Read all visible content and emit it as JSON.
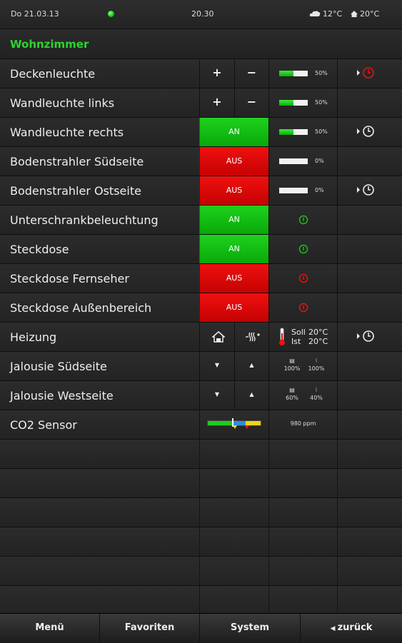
{
  "status": {
    "date": "Do 21.03.13",
    "time": "20.30",
    "outdoor_temp": "12°C",
    "indoor_temp": "20°C",
    "outdoor_icon": "cloud-icon",
    "indoor_icon": "house-icon",
    "connection_color": "#22cc22"
  },
  "room": {
    "title": "Wohnzimmer"
  },
  "colors": {
    "accent": "#2fd22f",
    "on": "#0fc00f",
    "off": "#e00808"
  },
  "rows": [
    {
      "label": "Deckenleuchte",
      "plus": "+",
      "minus": "−",
      "level": "50%",
      "level_fraction": 0.5,
      "timer_active": true
    },
    {
      "label": "Wandleuchte links",
      "plus": "+",
      "minus": "−",
      "level": "50%",
      "level_fraction": 0.5
    },
    {
      "label": "Wandleuchte rechts",
      "state": "AN",
      "level": "50%",
      "level_fraction": 0.5,
      "timer": true
    },
    {
      "label": "Bodenstrahler Südseite",
      "state": "AUS",
      "level": "0%",
      "level_fraction": 0
    },
    {
      "label": "Bodenstrahler Ostseite",
      "state": "AUS",
      "level": "0%",
      "level_fraction": 0,
      "timer": true
    },
    {
      "label": "Unterschrankbeleuchtung",
      "state": "AN"
    },
    {
      "label": "Steckdose",
      "state": "AN"
    },
    {
      "label": "Steckdose Fernseher",
      "state": "AUS"
    },
    {
      "label": "Steckdose Außenbereich",
      "state": "AUS"
    },
    {
      "label": "Heizung",
      "setpoint_label": "Soll",
      "setpoint": "20°C",
      "actual_label": "Ist",
      "actual": "20°C"
    },
    {
      "label": "Jalousie Südseite",
      "position": "100%",
      "angle": "100%"
    },
    {
      "label": "Jalousie Westseite",
      "position": "60%",
      "angle": "40%"
    },
    {
      "label": "CO2 Sensor",
      "value": "980 ppm"
    }
  ],
  "nav": {
    "menu": "Menü",
    "favorites": "Favoriten",
    "system": "System",
    "back": "zurück"
  }
}
